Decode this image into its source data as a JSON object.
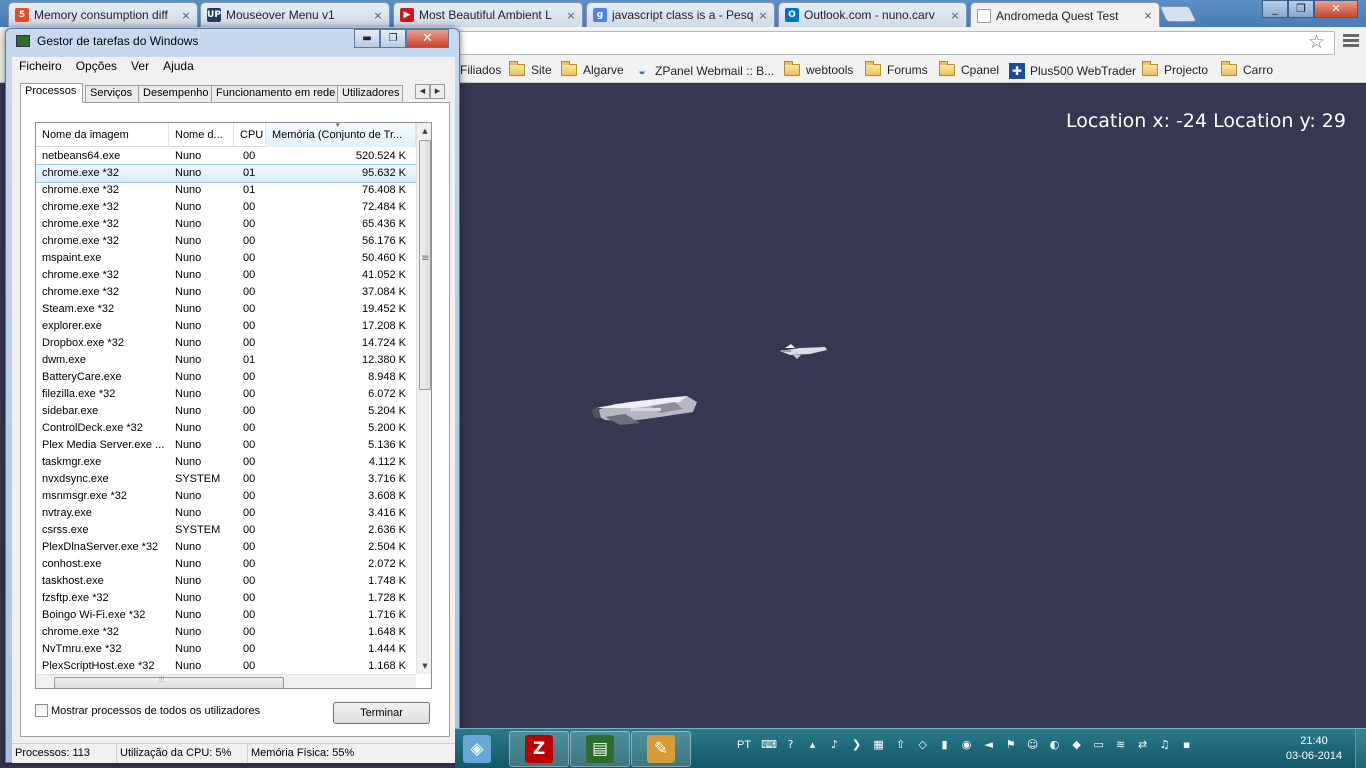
{
  "browser": {
    "tabs": [
      {
        "title": "Memory consumption diff",
        "icon": "html5-icon",
        "color": "#e44d26",
        "glyph": "5"
      },
      {
        "title": "Mouseover Menu v1",
        "icon": "up-logo-icon",
        "color": "#1f3a6e",
        "glyph": "UP"
      },
      {
        "title": "Most Beautiful Ambient L",
        "icon": "youtube-icon",
        "color": "#cc181e",
        "glyph": "▶"
      },
      {
        "title": "javascript class is a - Pesq",
        "icon": "google-icon",
        "color": "#4a86e8",
        "glyph": "g"
      },
      {
        "title": "Outlook.com - nuno.carv",
        "icon": "outlook-icon",
        "color": "#0072c6",
        "glyph": "O"
      },
      {
        "title": "Andromeda Quest Test",
        "icon": "page-icon",
        "color": "#ffffff",
        "glyph": ""
      }
    ],
    "bookmarks": [
      {
        "label": "Filiados",
        "icon": "none"
      },
      {
        "label": "Site",
        "icon": "folder-icon"
      },
      {
        "label": "Algarve",
        "icon": "folder-icon"
      },
      {
        "label": "ZPanel Webmail :: B...",
        "icon": "zpanel-icon"
      },
      {
        "label": "webtools",
        "icon": "folder-icon"
      },
      {
        "label": "Forums",
        "icon": "folder-icon"
      },
      {
        "label": "Cpanel",
        "icon": "folder-icon"
      },
      {
        "label": "Plus500 WebTrader",
        "icon": "plus500-icon"
      },
      {
        "label": "Projecto",
        "icon": "folder-icon"
      },
      {
        "label": "Carro",
        "icon": "folder-icon"
      }
    ]
  },
  "game": {
    "location_x_label": "Location x: -24",
    "location_y_label": "Location y: 29",
    "background": "#383751"
  },
  "taskmgr": {
    "title": "Gestor de tarefas do Windows",
    "menu": [
      "Ficheiro",
      "Opções",
      "Ver",
      "Ajuda"
    ],
    "tabs": [
      "Processos",
      "Serviços",
      "Desempenho",
      "Funcionamento em rede",
      "Utilizadores"
    ],
    "columns": [
      "Nome da imagem",
      "Nome d...",
      "CPU",
      "Memória (Conjunto de Tr..."
    ],
    "rows": [
      [
        "netbeans64.exe",
        "Nuno",
        "00",
        "520.524 K"
      ],
      [
        "chrome.exe *32",
        "Nuno",
        "01",
        "95.632 K"
      ],
      [
        "chrome.exe *32",
        "Nuno",
        "01",
        "76.408 K"
      ],
      [
        "chrome.exe *32",
        "Nuno",
        "00",
        "72.484 K"
      ],
      [
        "chrome.exe *32",
        "Nuno",
        "00",
        "65.436 K"
      ],
      [
        "chrome.exe *32",
        "Nuno",
        "00",
        "56.176 K"
      ],
      [
        "mspaint.exe",
        "Nuno",
        "00",
        "50.460 K"
      ],
      [
        "chrome.exe *32",
        "Nuno",
        "00",
        "41.052 K"
      ],
      [
        "chrome.exe *32",
        "Nuno",
        "00",
        "37.084 K"
      ],
      [
        "Steam.exe *32",
        "Nuno",
        "00",
        "19.452 K"
      ],
      [
        "explorer.exe",
        "Nuno",
        "00",
        "17.208 K"
      ],
      [
        "Dropbox.exe *32",
        "Nuno",
        "00",
        "14.724 K"
      ],
      [
        "dwm.exe",
        "Nuno",
        "01",
        "12.380 K"
      ],
      [
        "BatteryCare.exe",
        "Nuno",
        "00",
        "8.948 K"
      ],
      [
        "filezilla.exe *32",
        "Nuno",
        "00",
        "6.072 K"
      ],
      [
        "sidebar.exe",
        "Nuno",
        "00",
        "5.204 K"
      ],
      [
        "ControlDeck.exe *32",
        "Nuno",
        "00",
        "5.200 K"
      ],
      [
        "Plex Media Server.exe ...",
        "Nuno",
        "00",
        "5.136 K"
      ],
      [
        "taskmgr.exe",
        "Nuno",
        "00",
        "4.112 K"
      ],
      [
        "nvxdsync.exe",
        "SYSTEM",
        "00",
        "3.716 K"
      ],
      [
        "msnmsgr.exe *32",
        "Nuno",
        "00",
        "3.608 K"
      ],
      [
        "nvtray.exe",
        "Nuno",
        "00",
        "3.416 K"
      ],
      [
        "csrss.exe",
        "SYSTEM",
        "00",
        "2.636 K"
      ],
      [
        "PlexDlnaServer.exe *32",
        "Nuno",
        "00",
        "2.504 K"
      ],
      [
        "conhost.exe",
        "Nuno",
        "00",
        "2.072 K"
      ],
      [
        "taskhost.exe",
        "Nuno",
        "00",
        "1.748 K"
      ],
      [
        "fzsftp.exe *32",
        "Nuno",
        "00",
        "1.728 K"
      ],
      [
        "Boingo Wi-Fi.exe *32",
        "Nuno",
        "00",
        "1.716 K"
      ],
      [
        "chrome.exe *32",
        "Nuno",
        "00",
        "1.648 K"
      ],
      [
        "NvTmru.exe *32",
        "Nuno",
        "00",
        "1.444 K"
      ],
      [
        "PlexScriptHost.exe *32",
        "Nuno",
        "00",
        "1.168 K"
      ]
    ],
    "selected_row": 1,
    "show_all_label": "Mostrar processos de todos os utilizadores",
    "end_button": "Terminar",
    "status": {
      "processes": "Processos: 113",
      "cpu": "Utilização da CPU: 5%",
      "memory": "Memória Física: 55%"
    }
  },
  "taskbar": {
    "apps": [
      {
        "name": "virtualbox",
        "icon": "cube-icon",
        "color": "#6aa5d8",
        "glyph": "◈",
        "open": false
      },
      {
        "name": "filezilla",
        "icon": "filezilla-icon",
        "color": "#bf0000",
        "glyph": "Z",
        "open": true
      },
      {
        "name": "taskmgr",
        "icon": "monitor-icon",
        "color": "#2f6d2f",
        "glyph": "▤",
        "open": true
      },
      {
        "name": "paint",
        "icon": "palette-icon",
        "color": "#d89b3a",
        "glyph": "✎",
        "open": true
      }
    ],
    "language": "PT",
    "clock_time": "21:40",
    "clock_date": "03-06-2014"
  }
}
